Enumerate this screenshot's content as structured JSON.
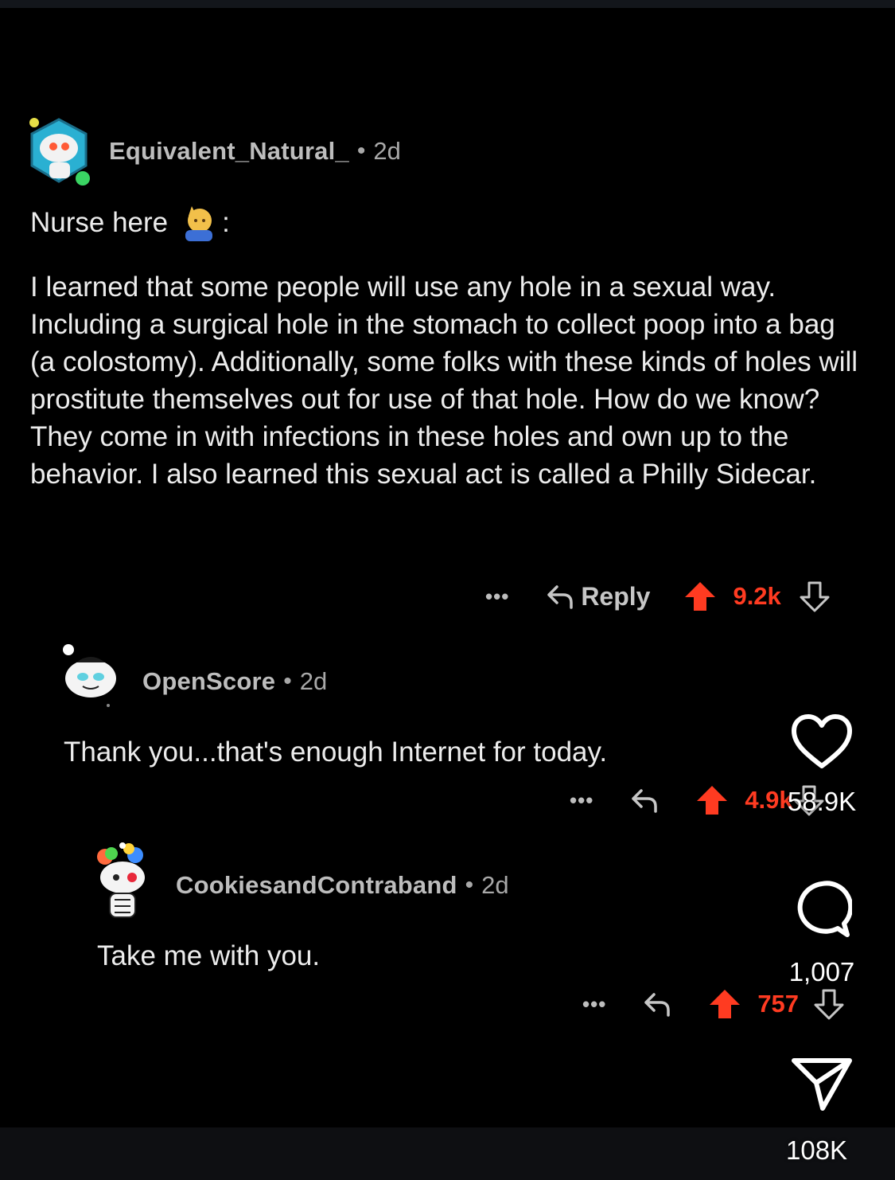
{
  "comments": [
    {
      "username": "Equivalent_Natural_",
      "age": "2d",
      "intro": "Nurse here",
      "intro_suffix": ":",
      "body": "I learned that some people will use any hole in a sexual way.  Including a surgical hole in the stomach to collect poop into a bag (a colostomy).  Additionally, some folks with these kinds of holes will prostitute themselves out for use of that hole.  How do we know?  They come in with infections in these holes and own up to the behavior.  I also learned this sexual act is called a Philly Sidecar.",
      "more": "•••",
      "reply_label": "Reply",
      "score": "9.2k"
    },
    {
      "username": "OpenScore",
      "age": "2d",
      "body": "Thank you...that's enough Internet for today.",
      "more": "•••",
      "score": "4.9k"
    },
    {
      "username": "CookiesandContraband",
      "age": "2d",
      "body": "Take me with you.",
      "more": "•••",
      "score": "757"
    }
  ],
  "separator": "•",
  "rail": {
    "likes": "58.9K",
    "comments": "1,007",
    "shares": "108K"
  },
  "colors": {
    "background": "#000000",
    "upvote": "#ff3b21",
    "text": "#ececec",
    "meta": "#a8a8a8"
  },
  "icons": [
    "robot-avatar",
    "ghost-avatar",
    "rainbow-avatar",
    "raised-hand-emoji",
    "reply-arrow-icon",
    "upvote-icon",
    "downvote-icon",
    "heart-icon",
    "comment-bubble-icon",
    "send-icon"
  ]
}
